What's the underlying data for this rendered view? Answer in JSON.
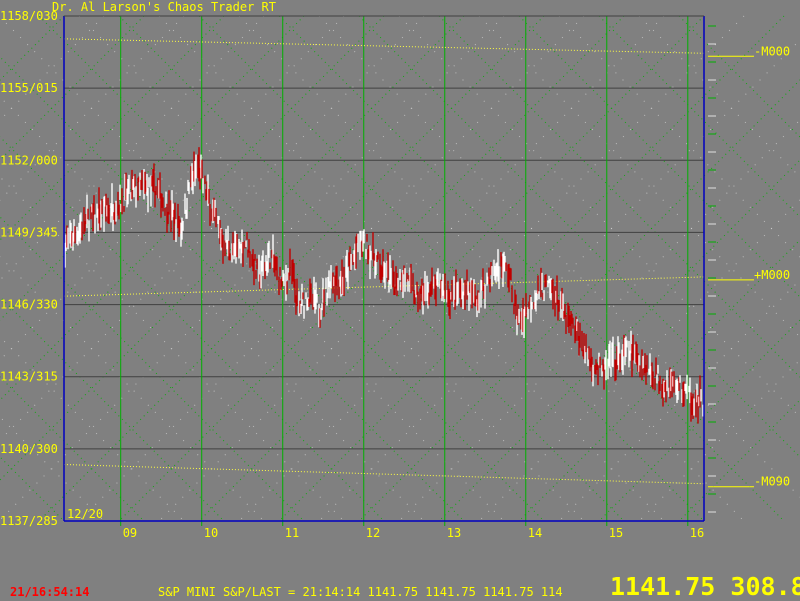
{
  "header": {
    "title": "Dr. Al Larson's Chaos Trader RT"
  },
  "footer": {
    "clock": "21/16:54:14",
    "ticker": "S&P MINI S&P/LAST = 21:14:14 1141.75 1141.75 1141.75 114",
    "big_price": "1141.75 308.8"
  },
  "colors": {
    "background": "#808080",
    "axis": "#0000c0",
    "grid_h": "#404040",
    "grid_v": "#00b000",
    "up_bar": "#ffffff",
    "down_bar": "#c00000",
    "moon_line": "#ffff40",
    "lattice": "#00b000",
    "label": "#ffff00"
  },
  "chart_data": {
    "type": "bar",
    "subtype": "ohlc-price-bars",
    "date_label": "12/20",
    "x_axis": {
      "labels": [
        "09",
        "10",
        "11",
        "12",
        "13",
        "14",
        "15",
        "16"
      ],
      "range": [
        8.3,
        16.2
      ]
    },
    "y_axis": {
      "labels": [
        "1158/030",
        "1155/015",
        "1152/000",
        "1149/345",
        "1146/330",
        "1143/315",
        "1140/300",
        "1137/285"
      ],
      "range": [
        1137.25,
        1158.25
      ]
    },
    "overlay_lines": [
      {
        "label": "-M000",
        "start": [
          8.3,
          1157.3
        ],
        "end": [
          16.2,
          1156.7
        ]
      },
      {
        "label": "+M000",
        "start": [
          8.3,
          1146.6
        ],
        "end": [
          16.2,
          1147.4
        ]
      },
      {
        "label": "-M090",
        "start": [
          8.3,
          1139.6
        ],
        "end": [
          16.2,
          1138.8
        ]
      }
    ],
    "price_path": [
      [
        8.3,
        1148.7
      ],
      [
        8.6,
        1149.8
      ],
      [
        8.9,
        1150.3
      ],
      [
        9.2,
        1151.1
      ],
      [
        9.45,
        1151.0
      ],
      [
        9.6,
        1150.2
      ],
      [
        9.75,
        1149.4
      ],
      [
        9.85,
        1151.2
      ],
      [
        9.95,
        1152.0
      ],
      [
        10.1,
        1150.5
      ],
      [
        10.25,
        1149.0
      ],
      [
        10.4,
        1148.4
      ],
      [
        10.55,
        1148.9
      ],
      [
        10.7,
        1147.4
      ],
      [
        10.85,
        1148.3
      ],
      [
        11.0,
        1147.0
      ],
      [
        11.1,
        1147.7
      ],
      [
        11.2,
        1146.0
      ],
      [
        11.3,
        1146.6
      ],
      [
        11.45,
        1146.1
      ],
      [
        11.6,
        1147.4
      ],
      [
        11.75,
        1147.3
      ],
      [
        11.85,
        1148.0
      ],
      [
        11.95,
        1148.8
      ],
      [
        12.05,
        1148.6
      ],
      [
        12.2,
        1147.8
      ],
      [
        12.35,
        1147.2
      ],
      [
        12.5,
        1147.5
      ],
      [
        12.65,
        1146.5
      ],
      [
        12.8,
        1146.8
      ],
      [
        12.95,
        1147.0
      ],
      [
        13.1,
        1146.5
      ],
      [
        13.25,
        1146.9
      ],
      [
        13.4,
        1146.4
      ],
      [
        13.55,
        1147.4
      ],
      [
        13.7,
        1147.9
      ],
      [
        13.8,
        1147.5
      ],
      [
        13.9,
        1145.5
      ],
      [
        14.05,
        1146.3
      ],
      [
        14.2,
        1147.0
      ],
      [
        14.35,
        1146.8
      ],
      [
        14.5,
        1145.6
      ],
      [
        14.65,
        1145.0
      ],
      [
        14.8,
        1143.9
      ],
      [
        14.95,
        1143.4
      ],
      [
        15.1,
        1143.9
      ],
      [
        15.3,
        1144.3
      ],
      [
        15.5,
        1143.6
      ],
      [
        15.7,
        1143.0
      ],
      [
        15.9,
        1142.8
      ],
      [
        16.05,
        1142.4
      ],
      [
        16.2,
        1142.0
      ]
    ]
  }
}
